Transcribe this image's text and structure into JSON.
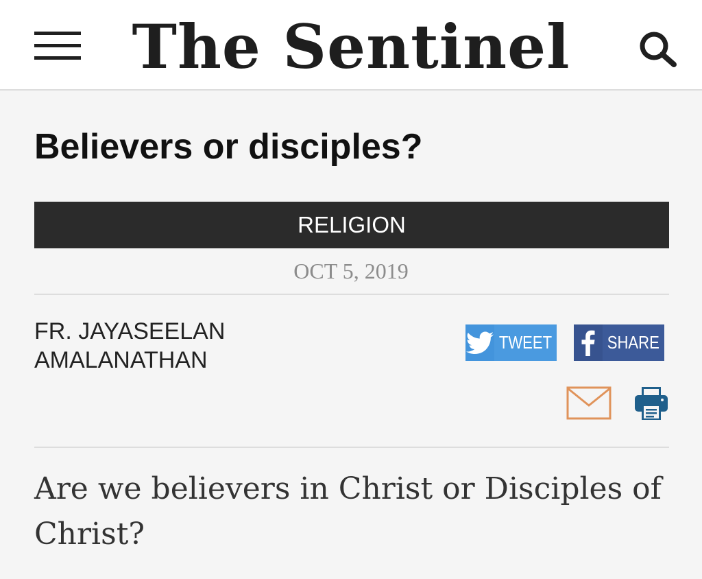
{
  "header": {
    "logo": "The Sentinel",
    "menu_icon": "hamburger-menu-icon",
    "search_icon": "search-icon"
  },
  "article": {
    "title": "Believers or disciples?",
    "category": "RELIGION",
    "date": "OCT 5, 2019",
    "author_line1": "FR. JAYASEELAN",
    "author_line2": "AMALANATHAN",
    "lead": "Are we believers in Christ or Disciples of Christ?"
  },
  "share": {
    "tweet_label": "TWEET",
    "share_label": "SHARE",
    "tweet_icon": "twitter-bird-icon",
    "share_icon": "facebook-icon",
    "email_icon": "email-envelope-icon",
    "print_icon": "printer-icon"
  },
  "colors": {
    "twitter": "#4a9ae0",
    "facebook": "#3c5a99",
    "email": "#e0935a",
    "print": "#1f5f8b",
    "category_bg": "#2b2b2b"
  }
}
